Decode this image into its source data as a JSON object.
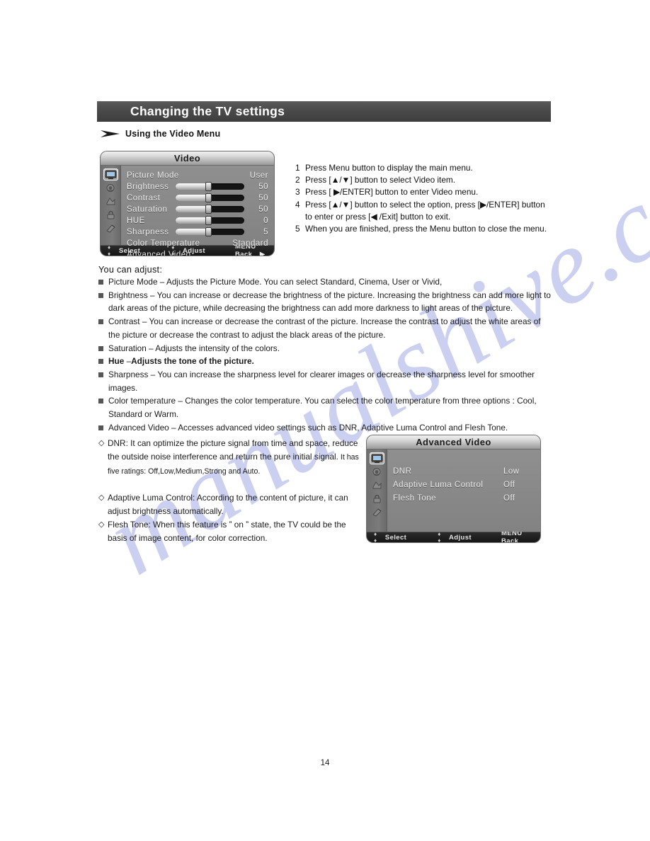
{
  "document": {
    "section_title": "Changing the TV settings",
    "subsection_title": "Using the Video Menu",
    "page_number": "14",
    "watermark": "manualshive.com"
  },
  "video_menu": {
    "title": "Video",
    "rows": [
      {
        "label": "Picture Mode",
        "value": "User",
        "type": "value"
      },
      {
        "label": "Brightness",
        "value": "50",
        "type": "slider",
        "percent": 47
      },
      {
        "label": "Contrast",
        "value": "50",
        "type": "slider",
        "percent": 47
      },
      {
        "label": "Saturation",
        "value": "50",
        "type": "slider",
        "percent": 47
      },
      {
        "label": "HUE",
        "value": "0",
        "type": "slider",
        "percent": 47
      },
      {
        "label": "Sharpness",
        "value": "5",
        "type": "slider",
        "percent": 47
      },
      {
        "label": "Color Temperature",
        "value": "Standard",
        "type": "value"
      },
      {
        "label": "Advanced Video",
        "value": "▶",
        "type": "submenu"
      }
    ],
    "footer": {
      "select_keys": "♦ ♦",
      "select_label": "Select",
      "adjust_keys": "♦ ♦",
      "adjust_label": "Adjust",
      "back_label": "MENU Back"
    }
  },
  "advanced_video_menu": {
    "title": "Advanced Video",
    "rows": [
      {
        "label": "DNR",
        "value": "Low"
      },
      {
        "label": "Adaptive Luma Control",
        "value": "Off"
      },
      {
        "label": "Flesh Tone",
        "value": "Off"
      }
    ],
    "footer": {
      "select_keys": "♦ ♦",
      "select_label": "Select",
      "adjust_keys": "♦ ♦",
      "adjust_label": "Adjust",
      "back_label": "MENU Back"
    }
  },
  "steps": [
    {
      "num": "1",
      "text": "Press Menu button to display the main menu."
    },
    {
      "num": "2",
      "text": "Press [▲/▼] button to select Video item."
    },
    {
      "num": "3",
      "text": "Press [ ▶/ENTER] button to enter Video menu."
    },
    {
      "num": "4",
      "text": "Press [▲/▼] button to select the option, press [▶/ENTER] button to enter or press [◀ /Exit] button to exit."
    },
    {
      "num": "5",
      "text": "When you are finished, press the Menu button to close the menu."
    }
  ],
  "adjust_section": {
    "heading": "You can adjust:",
    "items": [
      {
        "title": "Picture Mode",
        "dash": " – ",
        "text": "Adjusts the Picture Mode.  You can select  Standard,  Cinema,  User or Vivid,",
        "bold": false
      },
      {
        "title": "Brightness",
        "dash": " – ",
        "text": "You can increase or decrease the brightness of the picture.  Increasing the brightness can add more light to dark areas of the picture,  while decreasing the brightness can add more darkness to light areas of the picture.",
        "bold": false
      },
      {
        "title": "Contrast",
        "dash": " – ",
        "text": "You can increase or decrease the contrast of the picture.  Increase the contrast to adjust the white areas of the picture or decrease the contrast to adjust the black areas of the picture.",
        "bold": false
      },
      {
        "title": "Saturation",
        "dash": " – ",
        "text": "Adjusts the intensity of the colors.",
        "bold": false
      },
      {
        "title": "Hue",
        "dash": " –",
        "text": "Adjusts the tone of the picture.",
        "bold": true
      },
      {
        "title": "Sharpness",
        "dash": " – ",
        "text": "You can increase the sharpness level for clearer images or decrease the sharpness level for smoother images.",
        "bold": false
      },
      {
        "title": "Color temperature",
        "dash": " – ",
        "text": "Changes the color temperature.  You can select the color temperature from three options : Cool, Standard or Warm.",
        "bold": false
      },
      {
        "title": "Advanced Video",
        "dash": " – ",
        "text": "Accesses advanced video settings such as DNR,  Adaptive Luma Control and Flesh Tone.",
        "bold": false
      }
    ]
  },
  "notes": [
    {
      "marker": "◇",
      "label": "DNR",
      "text": ": It can optimize the picture signal from time and space, reduce the outside noise interference and return the pure initial signal.",
      "tail": " It has five ratings: Off,Low,Medium,Strong and Auto."
    },
    {
      "marker": "◇",
      "label": "Adaptive Luma Control",
      "text": ": According to the content of picture,  it can adjust brightness automatically.",
      "tail": ""
    },
    {
      "marker": "◇",
      "label": "Flesh Tone",
      "text": ": When this feature is ˮ on ˮ state,  the TV could be the basis of image content,  for color correction.",
      "tail": ""
    }
  ]
}
